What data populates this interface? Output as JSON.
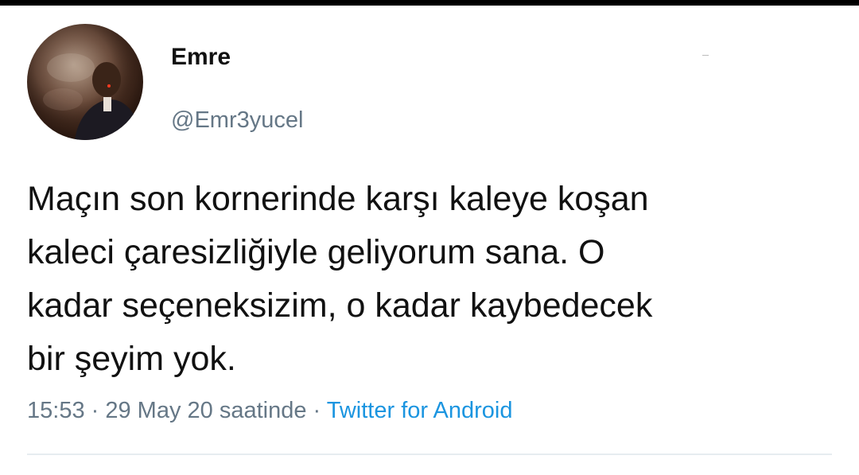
{
  "tweet": {
    "display_name": "Emre",
    "handle": "@Emr3yucel",
    "text": "Maçın son kornerinde karşı kaleye koşan\nkaleci çaresizliğiyle geliyorum sana. O\nkadar seçeneksizim, o kadar kaybedecek\nbir şeyim yok.",
    "time": "15:53",
    "separator": " · ",
    "date_label": "29 May 20 saatinde",
    "source": "Twitter for Android"
  },
  "avatar": {
    "icon": "user-avatar-photo"
  },
  "colors": {
    "text": "#111111",
    "secondary": "#657786",
    "link": "#1b95e0",
    "divider": "#e6ecf0"
  }
}
